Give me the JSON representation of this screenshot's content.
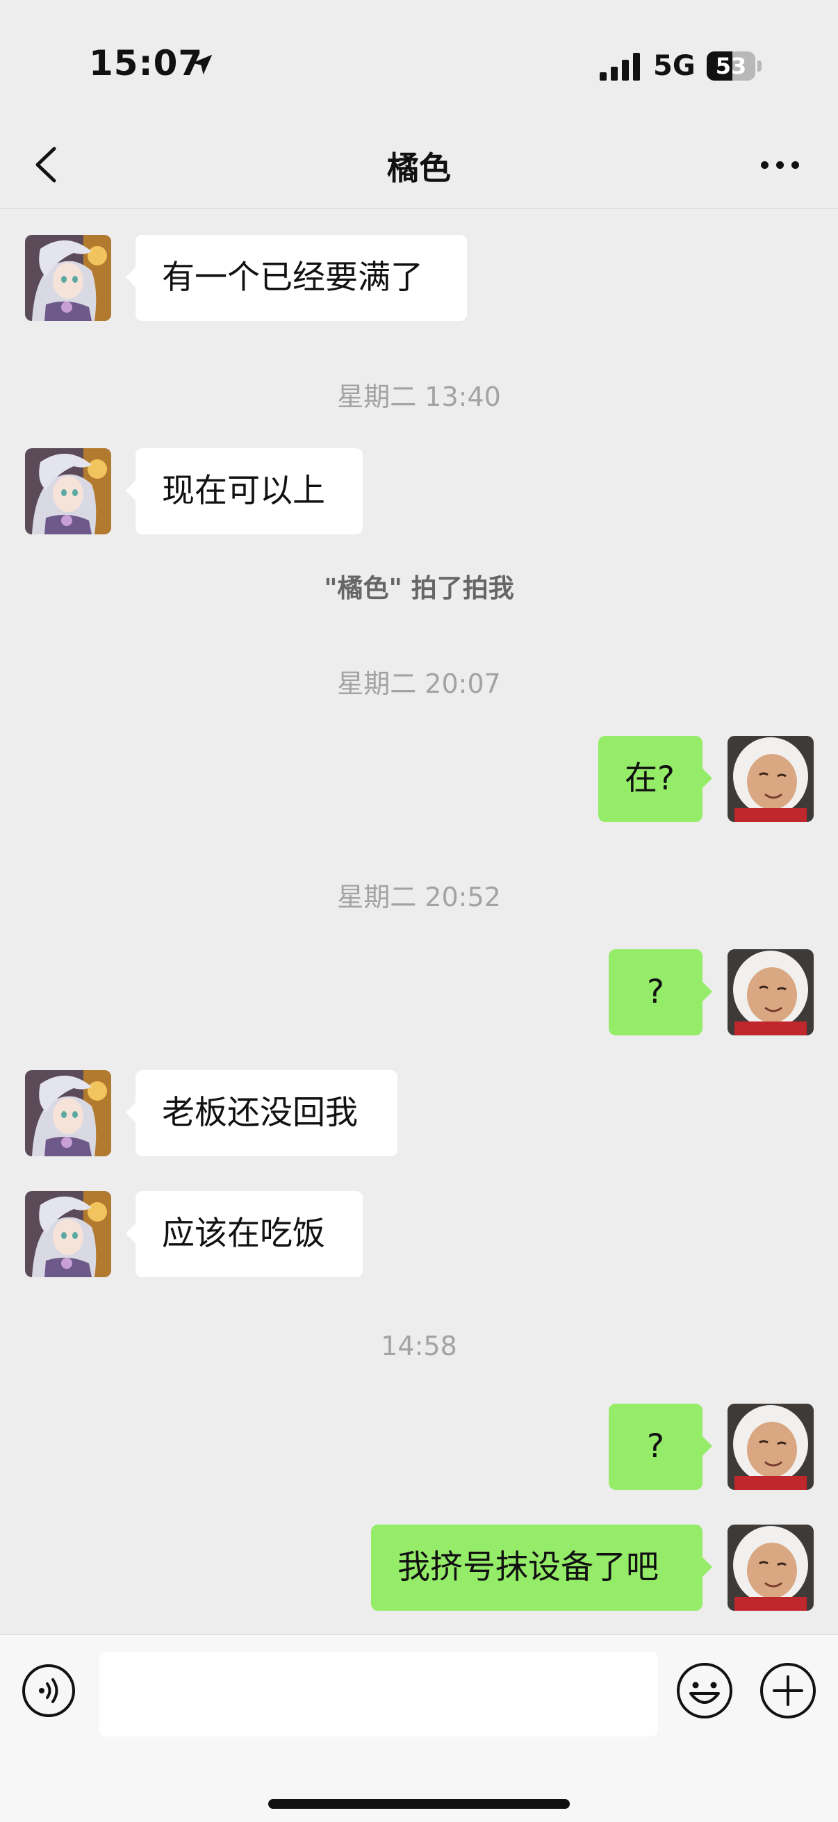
{
  "status_bar": {
    "time": "15:07",
    "network": "5G",
    "battery": "53",
    "battery_level_percent": 53,
    "icons": [
      "location-arrow-icon",
      "cellular-signal-icon",
      "battery-icon"
    ]
  },
  "nav": {
    "title": "橘色",
    "back_icon": "chevron-left-icon",
    "more_icon": "ellipsis-icon"
  },
  "messages": [
    {
      "type": "in",
      "text": "有一个已经要满了"
    },
    {
      "type": "time",
      "text": "星期二 13:40"
    },
    {
      "type": "in",
      "text": "现在可以上"
    },
    {
      "type": "system",
      "text": "\"橘色\" 拍了拍我"
    },
    {
      "type": "time",
      "text": "星期二 20:07"
    },
    {
      "type": "out",
      "text": "在?"
    },
    {
      "type": "time",
      "text": "星期二 20:52"
    },
    {
      "type": "out",
      "text": "?"
    },
    {
      "type": "in",
      "text": "老板还没回我"
    },
    {
      "type": "in",
      "text": "应该在吃饭"
    },
    {
      "type": "time",
      "text": "14:58"
    },
    {
      "type": "out",
      "text": "?"
    },
    {
      "type": "out",
      "text": "我挤号抹设备了吧"
    }
  ],
  "input_bar": {
    "text": "",
    "icons": [
      "voice-icon",
      "emoji-icon",
      "plus-icon"
    ]
  },
  "colors": {
    "background": "#ededed",
    "outgoing_bubble": "#95ec69",
    "incoming_bubble": "#ffffff",
    "timestamp_text": "#a3a3a3"
  }
}
